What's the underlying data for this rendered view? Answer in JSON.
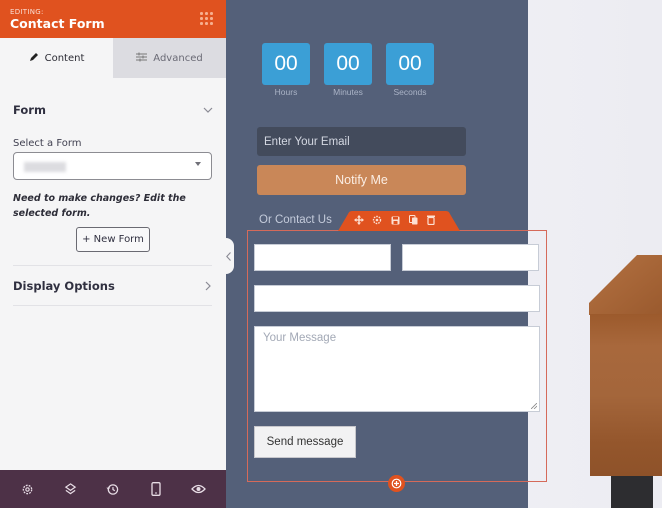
{
  "sidebar": {
    "header": {
      "editing_label": "EDITING:",
      "title": "Contact Form",
      "menu_icon": "grid-dots-icon"
    },
    "tabs": [
      {
        "label": "Content",
        "icon": "pencil-icon",
        "active": true
      },
      {
        "label": "Advanced",
        "icon": "sliders-icon",
        "active": false
      }
    ],
    "form_section": {
      "title": "Form",
      "expanded": true,
      "select_label": "Select a Form",
      "select_value": "",
      "note": "Need to make changes? Edit the selected form.",
      "new_form_button": "+ New Form"
    },
    "display_options": {
      "title": "Display Options",
      "expanded": false
    },
    "footer_icons": [
      "gear-icon",
      "layers-icon",
      "history-icon",
      "mobile-icon",
      "eye-icon"
    ]
  },
  "preview": {
    "countdown": [
      {
        "value": "00",
        "label": "Hours"
      },
      {
        "value": "00",
        "label": "Minutes"
      },
      {
        "value": "00",
        "label": "Seconds"
      }
    ],
    "email_placeholder": "Enter Your Email",
    "notify_button": "Notify Me",
    "contact_label": "Or Contact Us",
    "block_toolbar": [
      "move-icon",
      "settings-icon",
      "save-icon",
      "duplicate-icon",
      "delete-icon"
    ],
    "contact_form": {
      "message_placeholder": "Your Message",
      "send_button": "Send message"
    }
  },
  "colors": {
    "accent": "#e0521f",
    "panel": "#546079",
    "countdown": "#3b9fd6",
    "notify": "#c98758",
    "footer": "#4d3147"
  }
}
